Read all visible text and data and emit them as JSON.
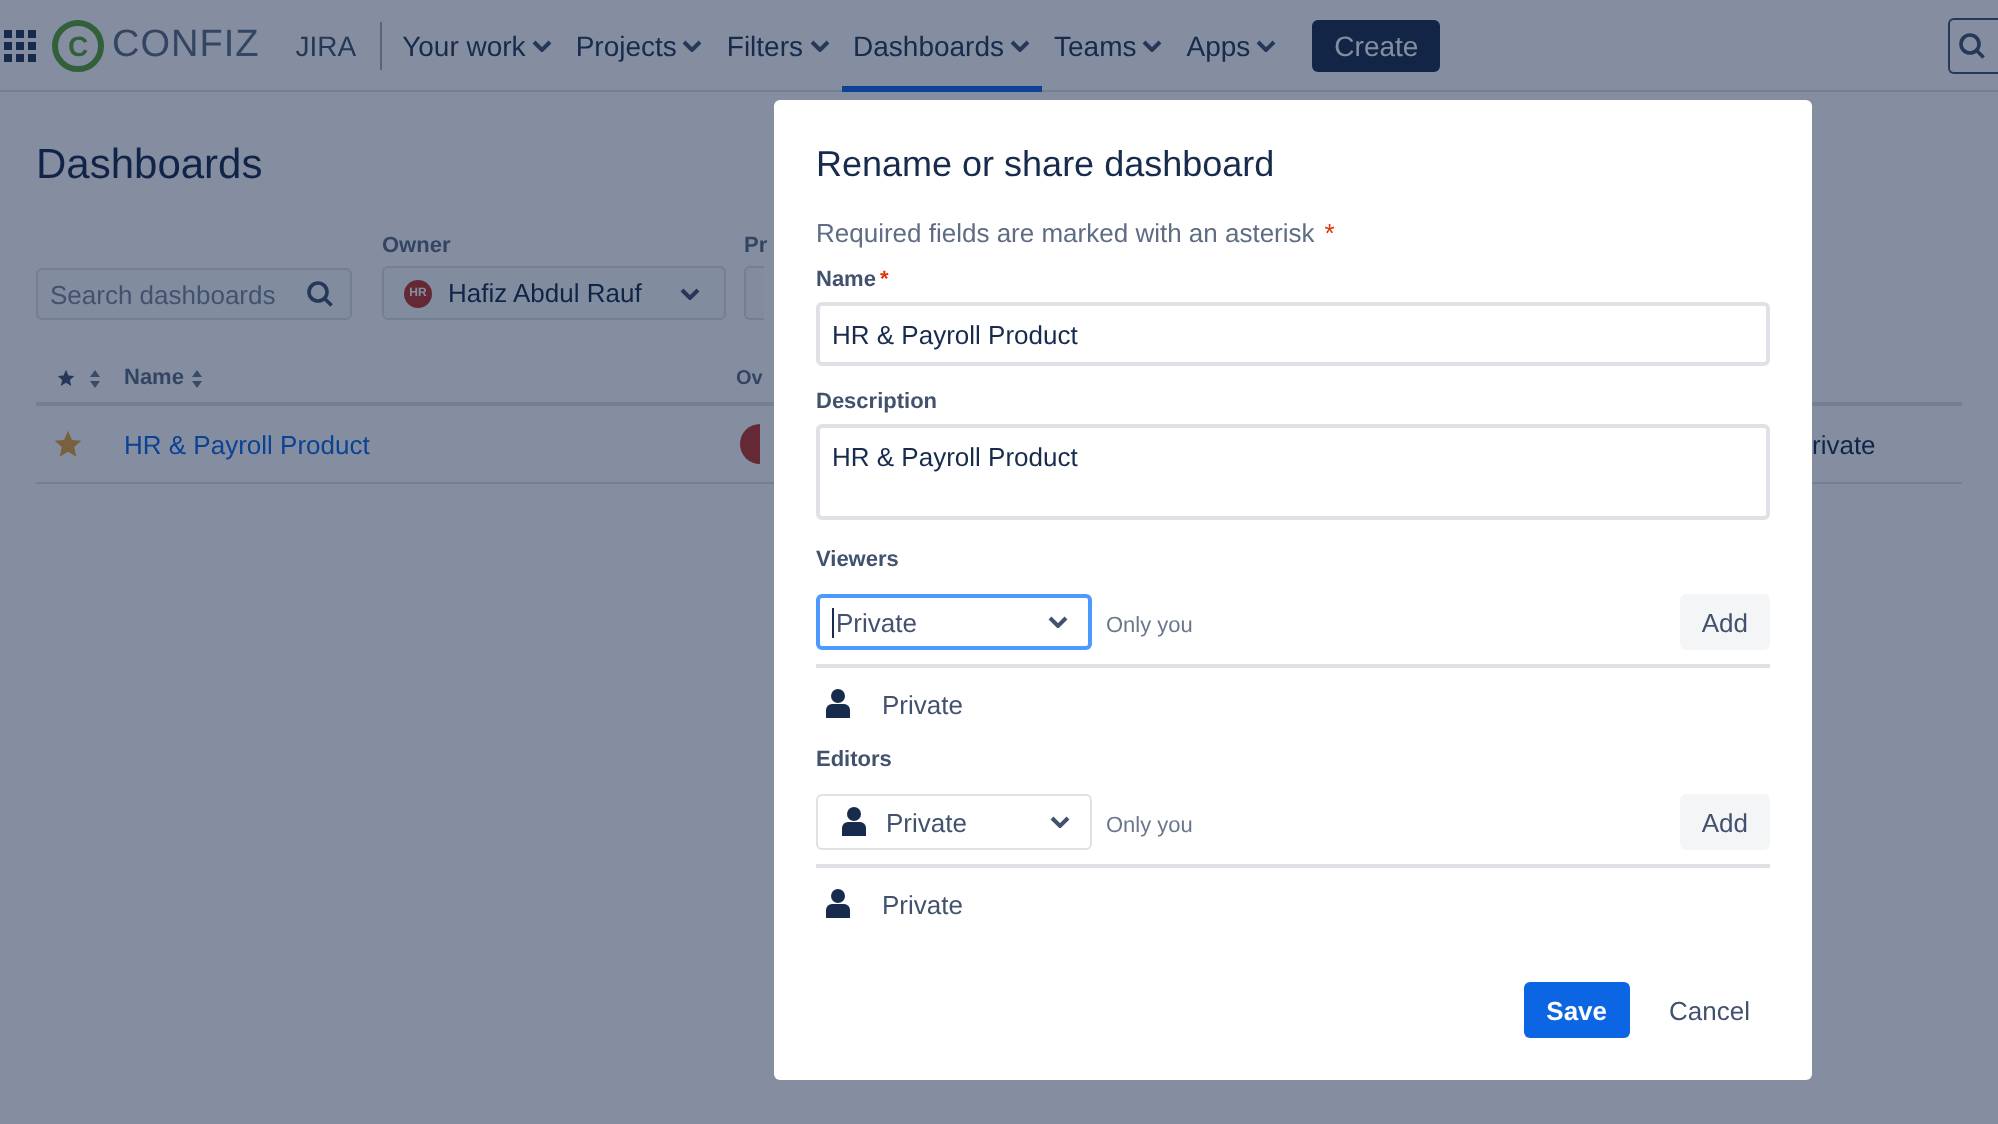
{
  "topbar": {
    "logo": {
      "mark": "C",
      "name": "CONFIZ"
    },
    "product": "JIRA",
    "nav": [
      {
        "label": "Your work",
        "selected": false
      },
      {
        "label": "Projects",
        "selected": false
      },
      {
        "label": "Filters",
        "selected": false
      },
      {
        "label": "Dashboards",
        "selected": true
      },
      {
        "label": "Teams",
        "selected": false
      },
      {
        "label": "Apps",
        "selected": false
      }
    ],
    "create": "Create"
  },
  "page": {
    "title": "Dashboards",
    "search": {
      "placeholder": "Search dashboards"
    },
    "owner": {
      "label": "Owner",
      "avatar": "HR",
      "value": "Hafiz Abdul Rauf"
    },
    "project": {
      "label": "Pr"
    },
    "table": {
      "columns": [
        {
          "label": "Name"
        },
        {
          "label": "Ov"
        }
      ],
      "rows": [
        {
          "starred": true,
          "name": "HR & Payroll Product",
          "viewers": "rivate"
        }
      ]
    }
  },
  "dialog": {
    "title": "Rename or share dashboard",
    "required_note": "Required fields are marked with an asterisk",
    "required_mark": "*",
    "name": {
      "label": "Name",
      "required_mark": "*",
      "value": "HR & Payroll Product"
    },
    "description": {
      "label": "Description",
      "value": "HR & Payroll Product"
    },
    "sections": [
      {
        "label": "Viewers",
        "select": {
          "kind": "plain",
          "value": "Private",
          "focused": true
        },
        "hint": "Only you",
        "add": "Add",
        "items": [
          {
            "label": "Private"
          }
        ]
      },
      {
        "label": "Editors",
        "select": {
          "kind": "person",
          "value": "Private",
          "focused": false
        },
        "hint": "Only you",
        "add": "Add",
        "items": [
          {
            "label": "Private"
          }
        ]
      }
    ],
    "save": "Save",
    "cancel": "Cancel"
  }
}
